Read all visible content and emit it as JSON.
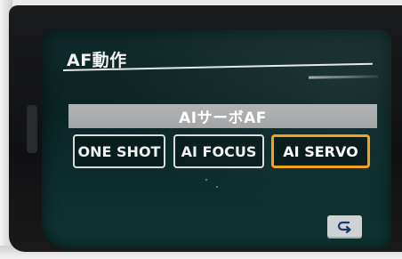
{
  "menu": {
    "title": "AF動作",
    "selected_mode": "AIサーボAF",
    "options": [
      {
        "label": "ONE SHOT",
        "selected": false
      },
      {
        "label": "AI FOCUS",
        "selected": false
      },
      {
        "label": "AI SERVO",
        "selected": true
      }
    ]
  },
  "controls": {
    "return_icon": "return-arrow-icon"
  },
  "colors": {
    "accent_selected": "#f2a31a",
    "screen_background": "#0c2b2b",
    "header_bar": "#aaacae"
  }
}
